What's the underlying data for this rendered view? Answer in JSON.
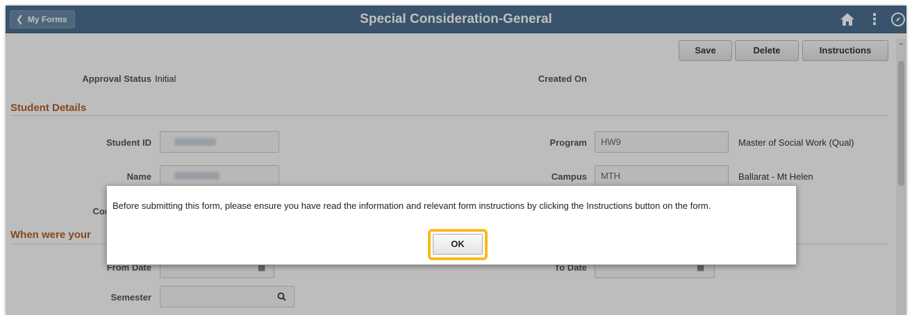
{
  "header": {
    "back_label": "My Forms",
    "title": "Special Consideration-General",
    "icons": [
      "home-icon",
      "more-vertical-icon",
      "navbar-compass-icon"
    ],
    "banner_color": "#4b6f8f"
  },
  "toolbar": {
    "save_label": "Save",
    "delete_label": "Delete",
    "instructions_label": "Instructions"
  },
  "form": {
    "approval_status_label": "Approval Status",
    "approval_status_value": "Initial",
    "created_on_label": "Created On",
    "student_details_heading": "Student Details",
    "student_id_label": "Student ID",
    "name_label": "Name",
    "contact_phone_label": "Contact Phon",
    "program_label": "Program",
    "program_value": "HW9",
    "program_desc": "Master of Social Work (Qual)",
    "campus_label": "Campus",
    "campus_value": "MTH",
    "campus_desc": "Ballarat - Mt Helen",
    "when_heading": "When were your",
    "from_date_label": "From Date",
    "to_date_label": "To Date",
    "semester_label": "Semester",
    "accent_color": "#b0602a"
  },
  "modal": {
    "message": "Before submitting this form, please ensure you have read the information and relevant form instructions by clicking the Instructions button on the form.",
    "ok_label": "OK",
    "highlight_color": "#f8bb1c"
  }
}
